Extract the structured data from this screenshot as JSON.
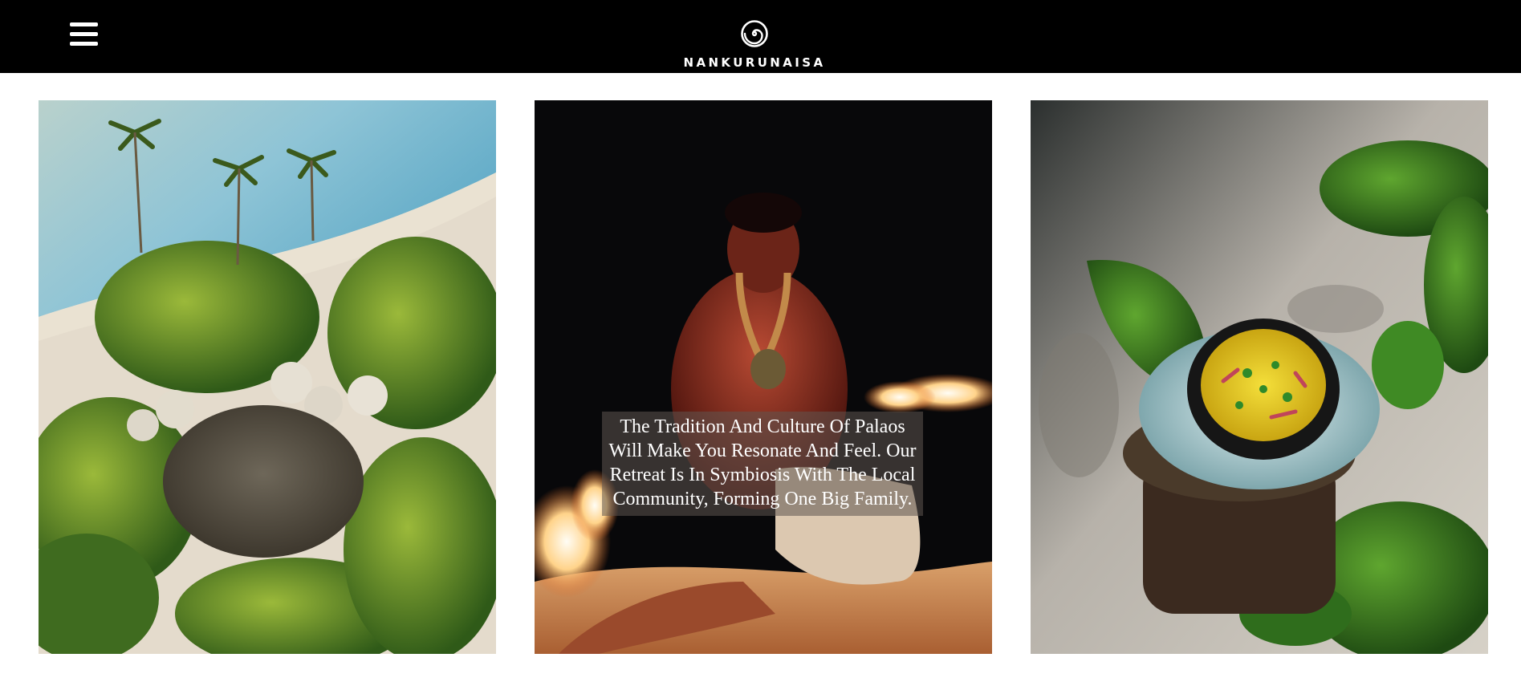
{
  "header": {
    "menu_icon": "hamburger-menu-icon",
    "logo_icon": "spiral-logo-icon",
    "brand_name": "NANKURUNAISA",
    "background": "#000000",
    "text_color": "#ffffff"
  },
  "gallery": {
    "cards": [
      {
        "image": "aerial-beach-resort-palm-trees",
        "caption": ""
      },
      {
        "image": "fire-dancer-on-sand",
        "caption": "The Tradition And Culture Of Palaos Will Make You Resonate And Feel. Our Retreat Is In Symbiosis With The Local Community, Forming One Big Family."
      },
      {
        "image": "dish-in-bowl-on-ice-with-leaves",
        "caption": ""
      }
    ]
  }
}
